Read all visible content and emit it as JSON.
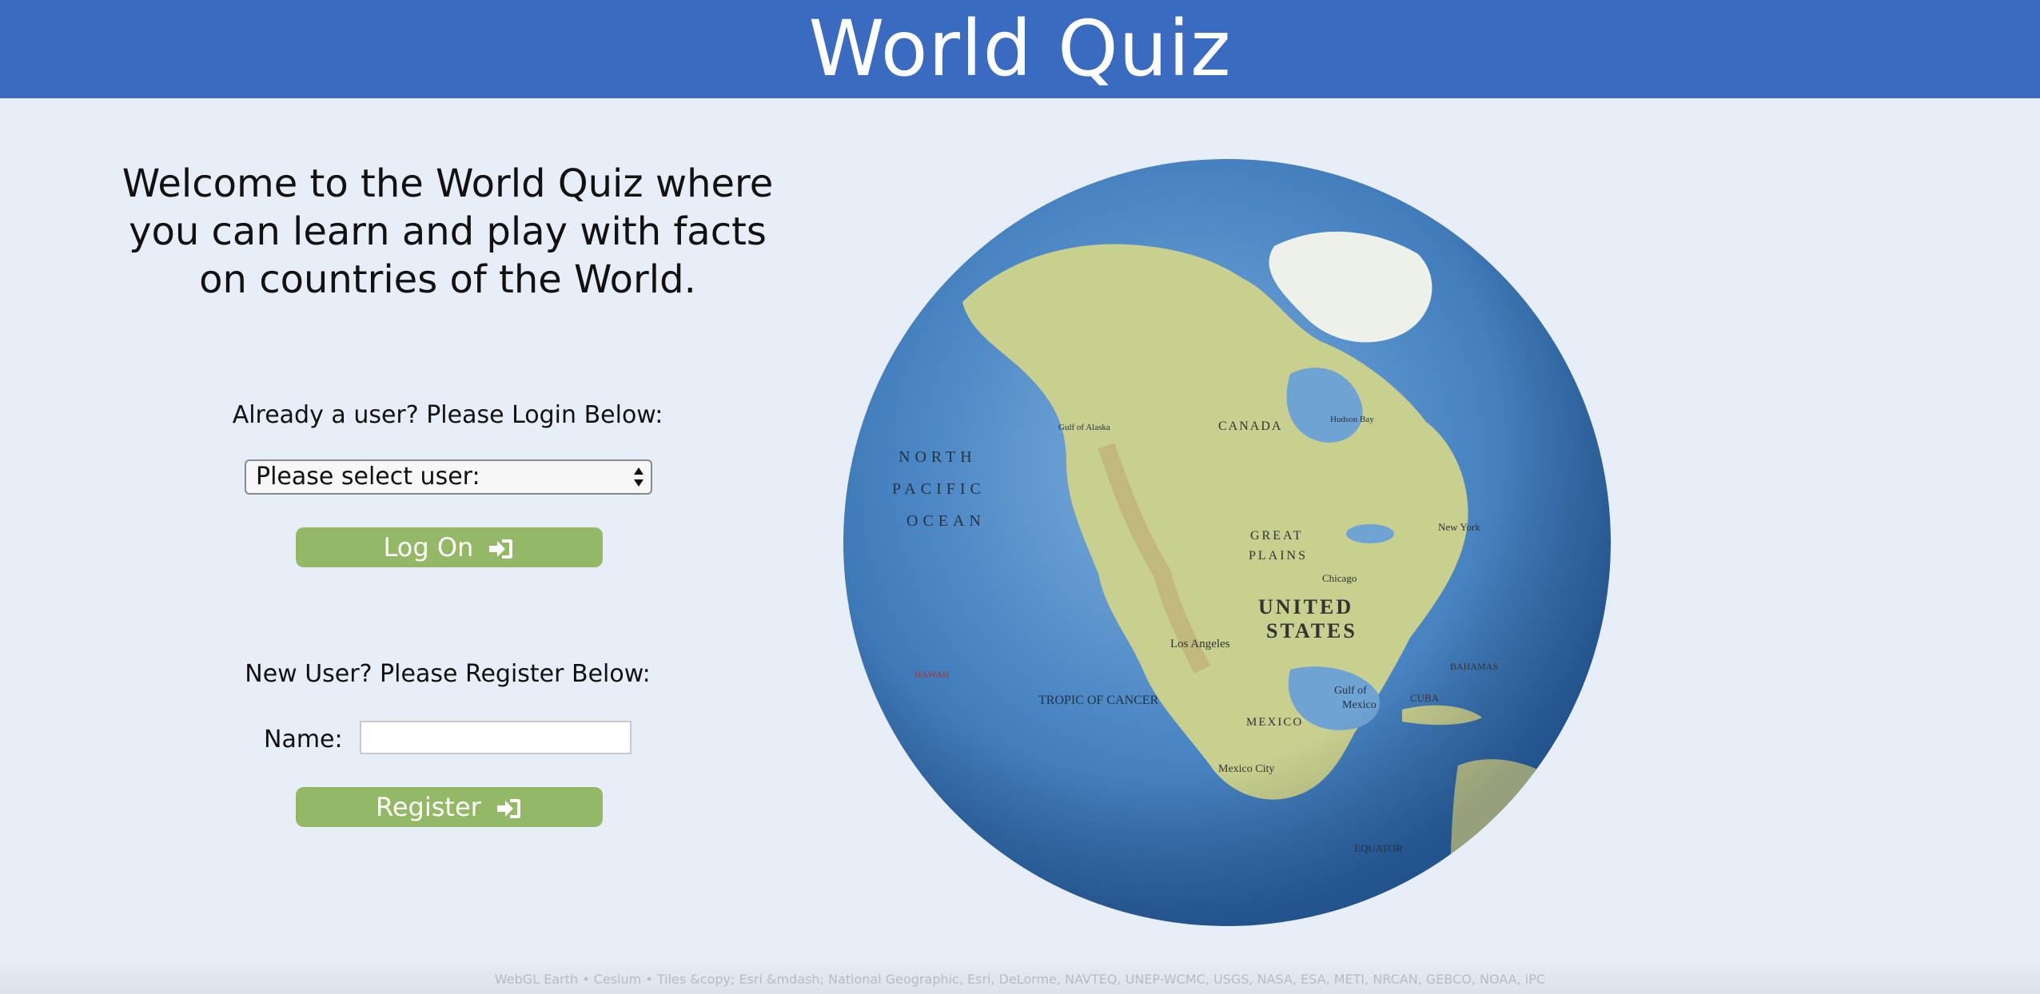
{
  "header": {
    "title": "World Quiz"
  },
  "welcome": {
    "line1": "Welcome to the World Quiz where",
    "line2": "you can learn and play with facts",
    "line3": "on countries of the World."
  },
  "login": {
    "prompt": "Already a user? Please Login Below:",
    "select_value": "Please select user:",
    "button_label": "Log On",
    "button_icon": "sign-in-icon"
  },
  "register": {
    "prompt": "New User? Please Register Below:",
    "name_label": "Name:",
    "name_value": "",
    "button_label": "Register",
    "button_icon": "sign-in-icon"
  },
  "globe": {
    "labels": [
      "CANADA",
      "UNITED",
      "STATES",
      "MEXICO",
      "Los Angeles",
      "Chicago",
      "New York",
      "Mexico City",
      "GREAT",
      "PLAINS",
      "NORTH",
      "PACIFIC",
      "OCEAN",
      "TROPIC OF CANCER",
      "Gulf of",
      "Mexico",
      "CUBA",
      "BAHAMAS",
      "HAWAII",
      "Hudson Bay",
      "Gulf of Alaska",
      "EQUATOR"
    ]
  },
  "footer": {
    "credits": "WebGL Earth • Cesium • Tiles &copy; Esri &mdash; National Geographic, Esri, DeLorme, NAVTEQ, UNEP-WCMC, USGS, NASA, ESA, METI, NRCAN, GEBCO, NOAA, iPC"
  },
  "colors": {
    "header_bg": "#3a6bc1",
    "page_bg": "#e8eef8",
    "button_bg": "#93b866",
    "ocean": "#4a86c4",
    "land": "#c8cf8f"
  }
}
